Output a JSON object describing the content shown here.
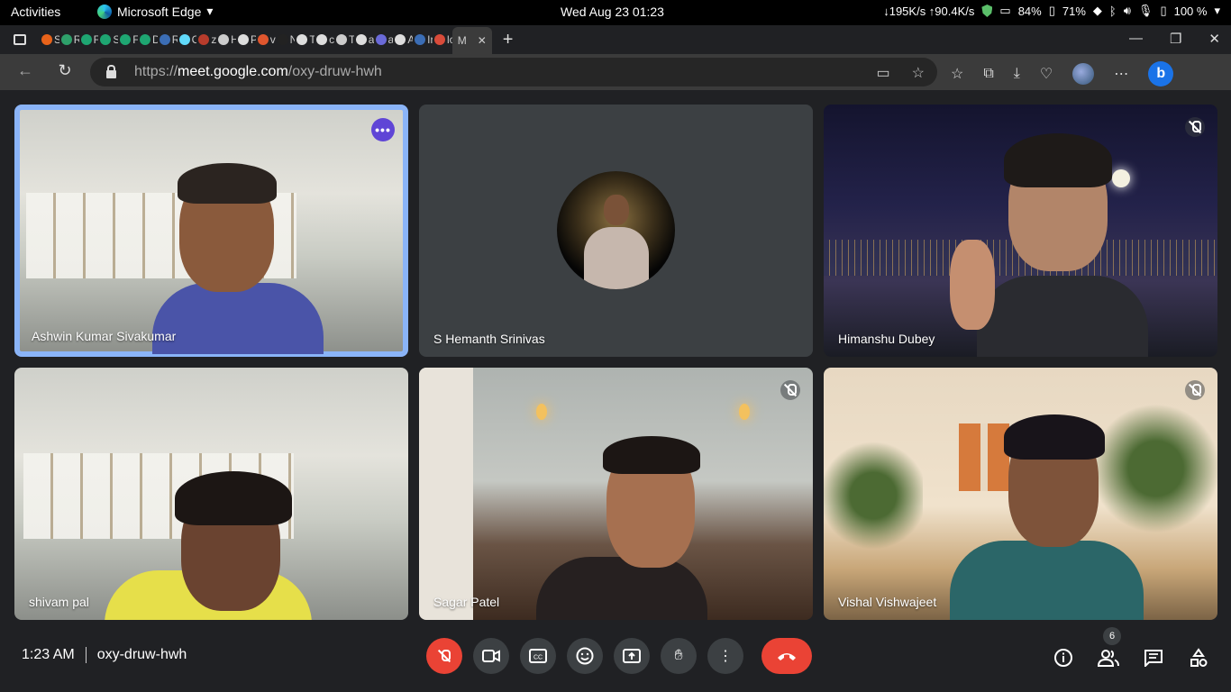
{
  "system": {
    "activities": "Activities",
    "app_name": "Microsoft Edge",
    "clock": "Wed Aug 23  01:23",
    "net_speed": "↓195K/s ↑90.4K/s",
    "battery_1": "84%",
    "battery_2": "71%",
    "battery_3": "100 %"
  },
  "browser": {
    "tabs": [
      "S",
      "R",
      "F",
      "S",
      "F",
      "D",
      "R",
      "C",
      "z",
      "H",
      "P",
      "v",
      "N",
      "T",
      "c",
      "T",
      "a",
      "a",
      "A",
      "Ir",
      "lc"
    ],
    "active_tab": "M",
    "url_scheme": "https://",
    "url_host": "meet.google.com",
    "url_path": "/oxy-druw-hwh"
  },
  "meet": {
    "participants": [
      {
        "name": "Ashwin Kumar Sivakumar",
        "muted": false,
        "speaking": true
      },
      {
        "name": "S Hemanth Srinivas",
        "muted": false,
        "speaking": false
      },
      {
        "name": "Himanshu Dubey",
        "muted": true,
        "speaking": false
      },
      {
        "name": "shivam pal",
        "muted": false,
        "speaking": false
      },
      {
        "name": "Sagar Patel",
        "muted": true,
        "speaking": false
      },
      {
        "name": "Vishal Vishwajeet",
        "muted": true,
        "speaking": false
      }
    ],
    "more_options_label": "•••",
    "time": "1:23 AM",
    "meeting_code": "oxy-druw-hwh",
    "participant_count": "6"
  },
  "colors": {
    "accent": "#8ab4f8",
    "danger": "#ea4335",
    "surface": "#3c4043",
    "background": "#202124"
  }
}
